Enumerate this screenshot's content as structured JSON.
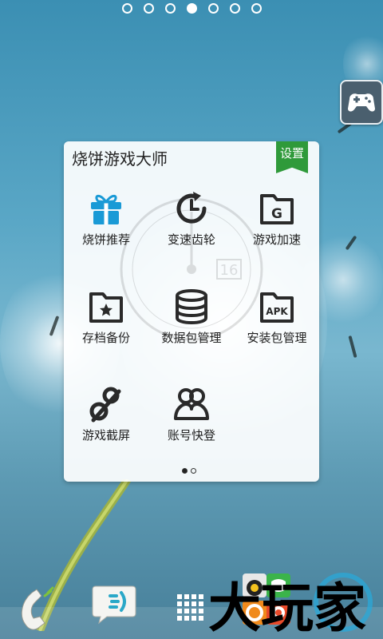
{
  "home": {
    "page_count": 7,
    "active_page": 4
  },
  "widget": {
    "title": "烧饼游戏大师",
    "settings_label": "设置",
    "clock_date": "16",
    "items": [
      {
        "label": "烧饼推荐",
        "icon": "gift-icon"
      },
      {
        "label": "变速齿轮",
        "icon": "speed-clock-icon"
      },
      {
        "label": "游戏加速",
        "icon": "folder-g-icon"
      },
      {
        "label": "存档备份",
        "icon": "folder-star-icon"
      },
      {
        "label": "数据包管理",
        "icon": "database-icon"
      },
      {
        "label": "安装包管理",
        "icon": "apk-icon"
      },
      {
        "label": "游戏截屏",
        "icon": "screenshot-icon"
      },
      {
        "label": "账号快登",
        "icon": "account-icon"
      }
    ],
    "page_dots": 2,
    "active_dot": 1,
    "accent_color": "#2f9a3a",
    "icon_color": "#2a2a2a",
    "highlight_icon_color": "#1a9ad6"
  },
  "dock": {
    "icons": [
      "phone-icon",
      "messaging-icon",
      "app-drawer-icon",
      "app-folder-icon"
    ]
  },
  "watermark": {
    "text": "大玩家"
  }
}
